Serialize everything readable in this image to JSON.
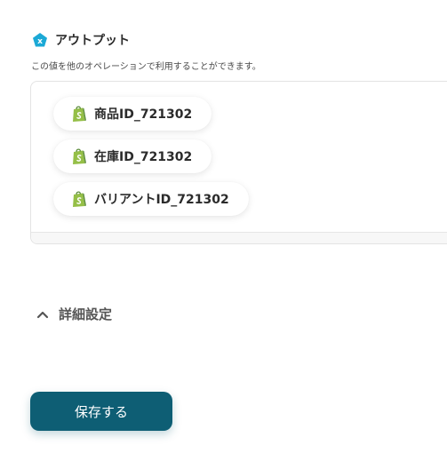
{
  "output": {
    "title": "アウトプット",
    "icon": "x-pentagon-icon",
    "icon_color": "#1ba9d6",
    "description": "この値を他のオペレーションで利用することができます。",
    "items": [
      {
        "label": "商品ID_721302",
        "icon": "shopify-icon"
      },
      {
        "label": "在庫ID_721302",
        "icon": "shopify-icon"
      },
      {
        "label": "バリアントID_721302",
        "icon": "shopify-icon"
      }
    ]
  },
  "advanced": {
    "label": "詳細設定",
    "icon": "chevron-up-icon"
  },
  "save_button": {
    "label": "保存する",
    "color": "#0e5e74"
  }
}
